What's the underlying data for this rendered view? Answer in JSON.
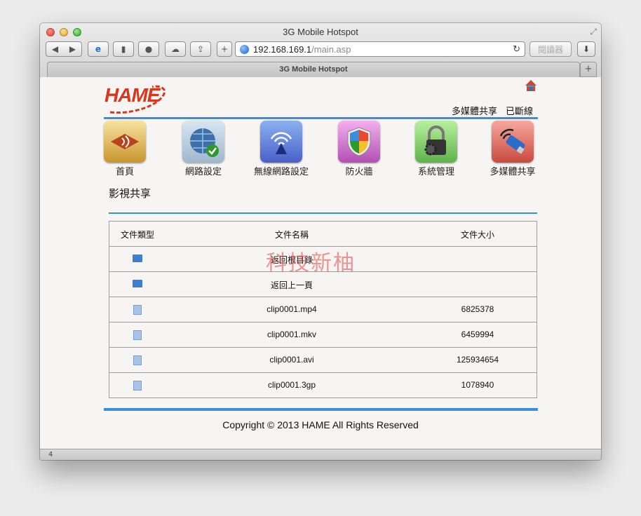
{
  "window": {
    "title": "3G Mobile Hotspot",
    "tab_title": "3G Mobile Hotspot",
    "url_host": "192.168.169.1",
    "url_path": "/main.asp",
    "reader_label": "閱讀器",
    "status_text": "4"
  },
  "page": {
    "logo_text": "HAME",
    "top_links": [
      "多媒體共享",
      "已斷線"
    ],
    "nav": [
      {
        "label": "首頁",
        "icon": "home-speaker-icon"
      },
      {
        "label": "網路設定",
        "icon": "globe-check-icon"
      },
      {
        "label": "無線網路設定",
        "icon": "wifi-tower-icon"
      },
      {
        "label": "防火牆",
        "icon": "shield-icon"
      },
      {
        "label": "系統管理",
        "icon": "lock-gear-icon"
      },
      {
        "label": "多媒體共享",
        "icon": "usb-drive-icon"
      }
    ],
    "section_title": "影視共享",
    "watermark": "科技新柚",
    "table": {
      "headers": [
        "文件類型",
        "文件名稱",
        "文件大小"
      ],
      "rows": [
        {
          "type": "folder",
          "name": "返回根目錄",
          "size": ""
        },
        {
          "type": "folder",
          "name": "返回上一頁",
          "size": ""
        },
        {
          "type": "file",
          "name": "clip0001.mp4",
          "size": "6825378"
        },
        {
          "type": "file",
          "name": "clip0001.mkv",
          "size": "6459994"
        },
        {
          "type": "file",
          "name": "clip0001.avi",
          "size": "125934654"
        },
        {
          "type": "file",
          "name": "clip0001.3gp",
          "size": "1078940"
        }
      ]
    },
    "copyright": "Copyright © 2013 HAME All Rights Reserved"
  },
  "colors": {
    "accent_line": "#3a8ee0",
    "logo_red": "#d9361c",
    "table_border": "#7fa6cf"
  }
}
